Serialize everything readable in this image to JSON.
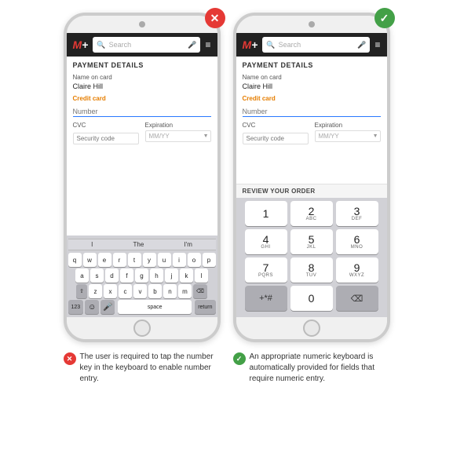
{
  "phones": {
    "bad": {
      "badge_symbol": "✕",
      "badge_color": "#e53935",
      "header": {
        "logo": "M+",
        "search_placeholder": "Search",
        "menu": "≡"
      },
      "payment_title": "PAYMENT DETAILS",
      "fields": {
        "name_label": "Name on card",
        "name_value": "Claire Hill",
        "card_label": "Credit card",
        "number_placeholder": "Number",
        "cvc_label": "CVC",
        "cvc_placeholder": "Security code",
        "expiry_label": "Expiration",
        "expiry_placeholder": "MM/YY"
      },
      "keyboard": {
        "suggestions": [
          "I",
          "The",
          "I'm"
        ],
        "row1": [
          "q",
          "w",
          "e",
          "r",
          "t",
          "y",
          "u",
          "i",
          "o",
          "p"
        ],
        "row2": [
          "a",
          "s",
          "d",
          "f",
          "g",
          "h",
          "j",
          "k",
          "l"
        ],
        "row3": [
          "z",
          "x",
          "c",
          "v",
          "b",
          "n",
          "m"
        ],
        "bottom": {
          "left": "123",
          "space": "space",
          "right": "return"
        }
      }
    },
    "good": {
      "badge_symbol": "✓",
      "badge_color": "#43a047",
      "header": {
        "logo": "M+",
        "search_placeholder": "Search",
        "menu": "≡"
      },
      "payment_title": "PAYMENT DETAILS",
      "fields": {
        "name_label": "Name on card",
        "name_value": "Claire Hill",
        "card_label": "Credit card",
        "number_placeholder": "Number",
        "cvc_label": "CVC",
        "cvc_placeholder": "Security code",
        "expiry_label": "Expiration",
        "expiry_placeholder": "MM/YY"
      },
      "review_label": "REVIEW YOUR ORDER",
      "numpad": {
        "keys": [
          {
            "digit": "1",
            "letters": ""
          },
          {
            "digit": "2",
            "letters": "ABC"
          },
          {
            "digit": "3",
            "letters": "DEF"
          },
          {
            "digit": "4",
            "letters": "GHI"
          },
          {
            "digit": "5",
            "letters": "JKL"
          },
          {
            "digit": "6",
            "letters": "MNO"
          },
          {
            "digit": "7",
            "letters": "PQRS"
          },
          {
            "digit": "8",
            "letters": "TUV"
          },
          {
            "digit": "9",
            "letters": "WXYZ"
          }
        ],
        "bottom_left": "+*#",
        "zero": "0",
        "backspace": "⌫"
      }
    }
  },
  "captions": {
    "bad": {
      "symbol": "✕",
      "color": "#e53935",
      "text": "The user is required to tap the number key in the keyboard to enable number entry."
    },
    "good": {
      "symbol": "✓",
      "color": "#43a047",
      "text": "An appropriate numeric keyboard is automatically provided for fields that require numeric entry."
    }
  }
}
